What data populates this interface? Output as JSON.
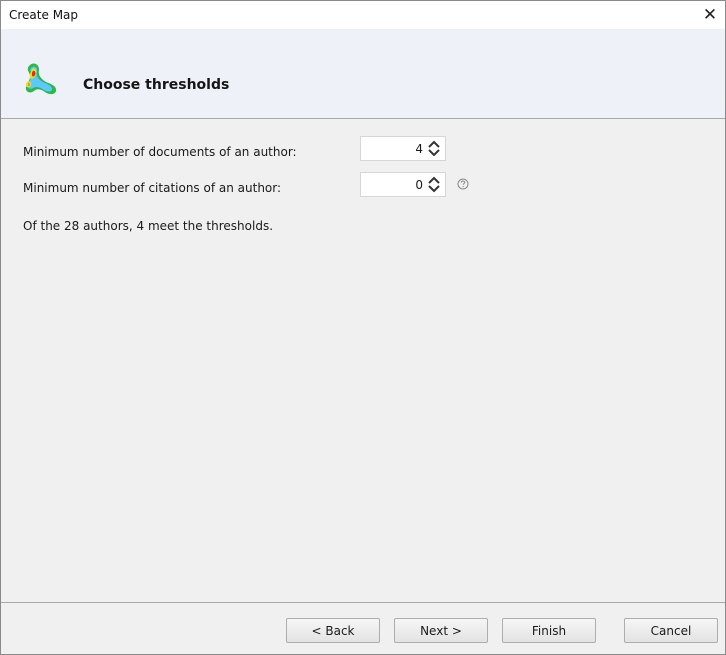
{
  "window": {
    "title": "Create Map",
    "close_glyph": "✕"
  },
  "header": {
    "title": "Choose thresholds",
    "icon": "heatmap-logo-icon"
  },
  "thresholds": {
    "min_documents_label": "Minimum number of documents of an author:",
    "min_documents_value": "4",
    "min_citations_label": "Minimum number of citations of an author:",
    "min_citations_value": "0",
    "help_icon": "help-circle-icon"
  },
  "summary": "Of the 28 authors, 4 meet the thresholds.",
  "footer": {
    "back_label": "< Back",
    "next_label": "Next >",
    "finish_label": "Finish",
    "cancel_label": "Cancel"
  }
}
